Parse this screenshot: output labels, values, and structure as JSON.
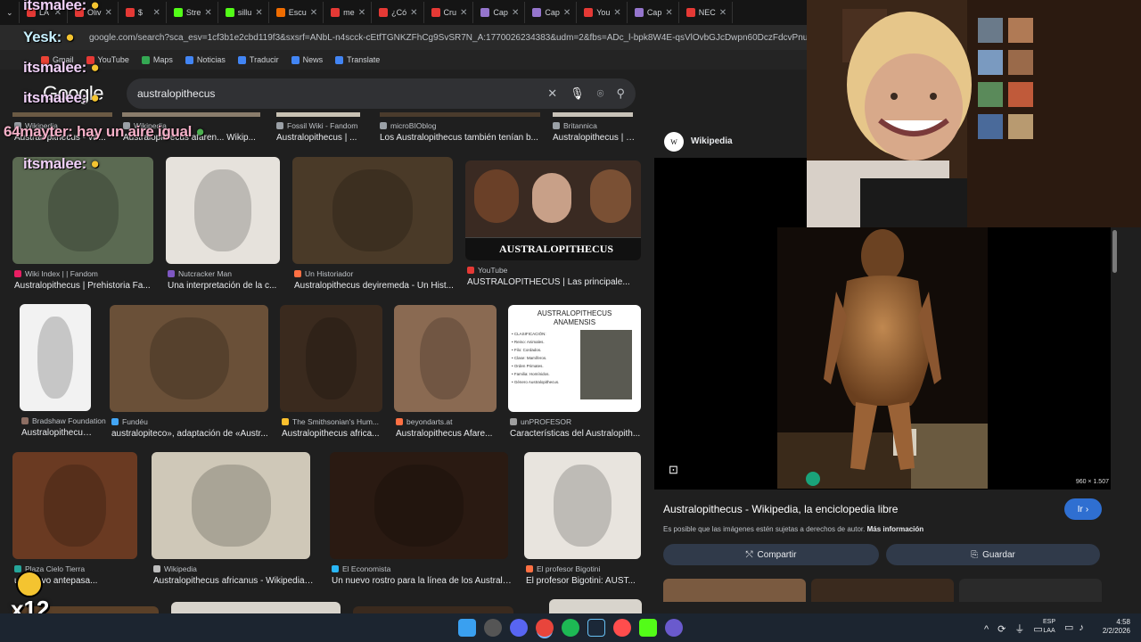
{
  "browser": {
    "tabs": [
      {
        "label": "LA",
        "color": "#e53935"
      },
      {
        "label": "Oliv",
        "color": "#e53935"
      },
      {
        "label": "$",
        "color": "#e53935"
      },
      {
        "label": "Stre",
        "color": "#53fc18"
      },
      {
        "label": "sillu",
        "color": "#53fc18"
      },
      {
        "label": "Escu",
        "color": "#ef6c00"
      },
      {
        "label": "me",
        "color": "#e53935"
      },
      {
        "label": "¿Có",
        "color": "#e53935"
      },
      {
        "label": "Cru",
        "color": "#e53935"
      },
      {
        "label": "Cap",
        "color": "#9575cd"
      },
      {
        "label": "Cap",
        "color": "#9575cd"
      },
      {
        "label": "You",
        "color": "#e53935"
      },
      {
        "label": "Cap",
        "color": "#9575cd"
      },
      {
        "label": "NEC",
        "color": "#e53935"
      }
    ],
    "url": "google.com/search?sca_esv=1cf3b1e2cbd119f3&sxsrf=ANbL-n4scck-cEtfTGNKZFhCg9SvSR7N_A:1770026234383&udm=2&fbs=ADc_l-bpk8W4E-qsVlOvbGJcDwpn60DczFdcvPnuv8WQohHLTaf9",
    "bookmarks": [
      {
        "label": "Gmail",
        "color": "#ea4335"
      },
      {
        "label": "YouTube",
        "color": "#e53935"
      },
      {
        "label": "Maps",
        "color": "#34a853"
      },
      {
        "label": "Noticias",
        "color": "#4285f4"
      },
      {
        "label": "Traducir",
        "color": "#4285f4"
      },
      {
        "label": "News",
        "color": "#4285f4"
      },
      {
        "label": "Translate",
        "color": "#4285f4"
      }
    ]
  },
  "google": {
    "logo": "Google",
    "query": "australopithecus"
  },
  "chat_overlay": {
    "line1": "itsmalee:",
    "line2": "Yesk:",
    "line3": "itsmalee:",
    "line4": "itsmalee:",
    "line5": "64mayter: hay un aire igual",
    "line6": "itsmalee:",
    "multiplier": "x12"
  },
  "results_top_row": [
    {
      "source": "Wikipedia",
      "title": "Australopithecus - Wi..."
    },
    {
      "source": "Wikipedia",
      "title": "Australopithecus afaren... Wikip..."
    },
    {
      "source": "Fossil Wiki - Fandom",
      "title": "Australopithecus | ..."
    },
    {
      "source": "microBIOblog",
      "title": "Los Australopithecus también tenían b..."
    },
    {
      "source": "Britannica",
      "title": "Australopithecus | C..."
    }
  ],
  "results": [
    {
      "source": "Wiki Index | | Fandom",
      "title": "Australopithecus | Prehistoria Fa...",
      "color": "#e91e63"
    },
    {
      "source": "Nutcracker Man",
      "title": "Una interpretación de la c...",
      "color": "#7e57c2"
    },
    {
      "source": "Un Historiador",
      "title": "Australopithecus deyiremeda - Un Hist...",
      "color": "#ff7043"
    },
    {
      "source": "YouTube",
      "title": "AUSTRALOPITHECUS | Las principale...",
      "color": "#e53935"
    },
    {
      "source": "Bradshaw Foundation",
      "title": "Australopithecus af...",
      "color": "#8d6e63"
    },
    {
      "source": "Fundéu",
      "title": "australopiteco», adaptación de «Austr...",
      "color": "#42a5f5"
    },
    {
      "source": "The Smithsonian's Hum...",
      "title": "Australopithecus africa...",
      "color": "#fbc02d"
    },
    {
      "source": "beyondarts.at",
      "title": "Australopithecus Afare...",
      "color": "#ff7043"
    },
    {
      "source": "unPROFESOR",
      "title": "Características del Australopith...",
      "color": "#9e9e9e"
    },
    {
      "source": "Plaza Cielo Tierra",
      "title": "un nuevo antepasa...",
      "color": "#26a69a"
    },
    {
      "source": "Wikipedia",
      "title": "Australopithecus africanus - Wikipedia,...",
      "color": "#bdbdbd"
    },
    {
      "source": "El Economista",
      "title": "Un nuevo rostro para la línea de los Australop...",
      "color": "#29b6f6"
    },
    {
      "source": "El profesor Bigotini",
      "title": "El profesor Bigotini: AUST...",
      "color": "#ff7043"
    }
  ],
  "thumb_text": {
    "youtube_banner": "AUSTRALOPITHECUS",
    "chart_title_1": "AUSTRALOPITHECUS",
    "chart_title_2": "ANAMENSIS",
    "chart_lines": [
      "• CLASIFICACIÓN:",
      "• Reino: Animales.",
      "• Filo: Cordados.",
      "• Clase: Mamíferos.",
      "• Orden Primates.",
      "• Familia: Homínidos.",
      "• Género Australopithecus."
    ]
  },
  "panel": {
    "site": "Wikipedia",
    "site_initial": "W",
    "dimensions": "960 × 1.507",
    "title": "Australopithecus - Wikipedia, la enciclopedia libre",
    "go_button": "Ir",
    "copyright": "Es posible que las imágenes estén sujetas a derechos de autor.",
    "more_info": "Más información",
    "share": "Compartir",
    "save": "Guardar"
  },
  "taskbar": {
    "lang_top": "ESP",
    "lang_bottom": "LAA",
    "time": "4:58",
    "date": "2/2/2026"
  }
}
